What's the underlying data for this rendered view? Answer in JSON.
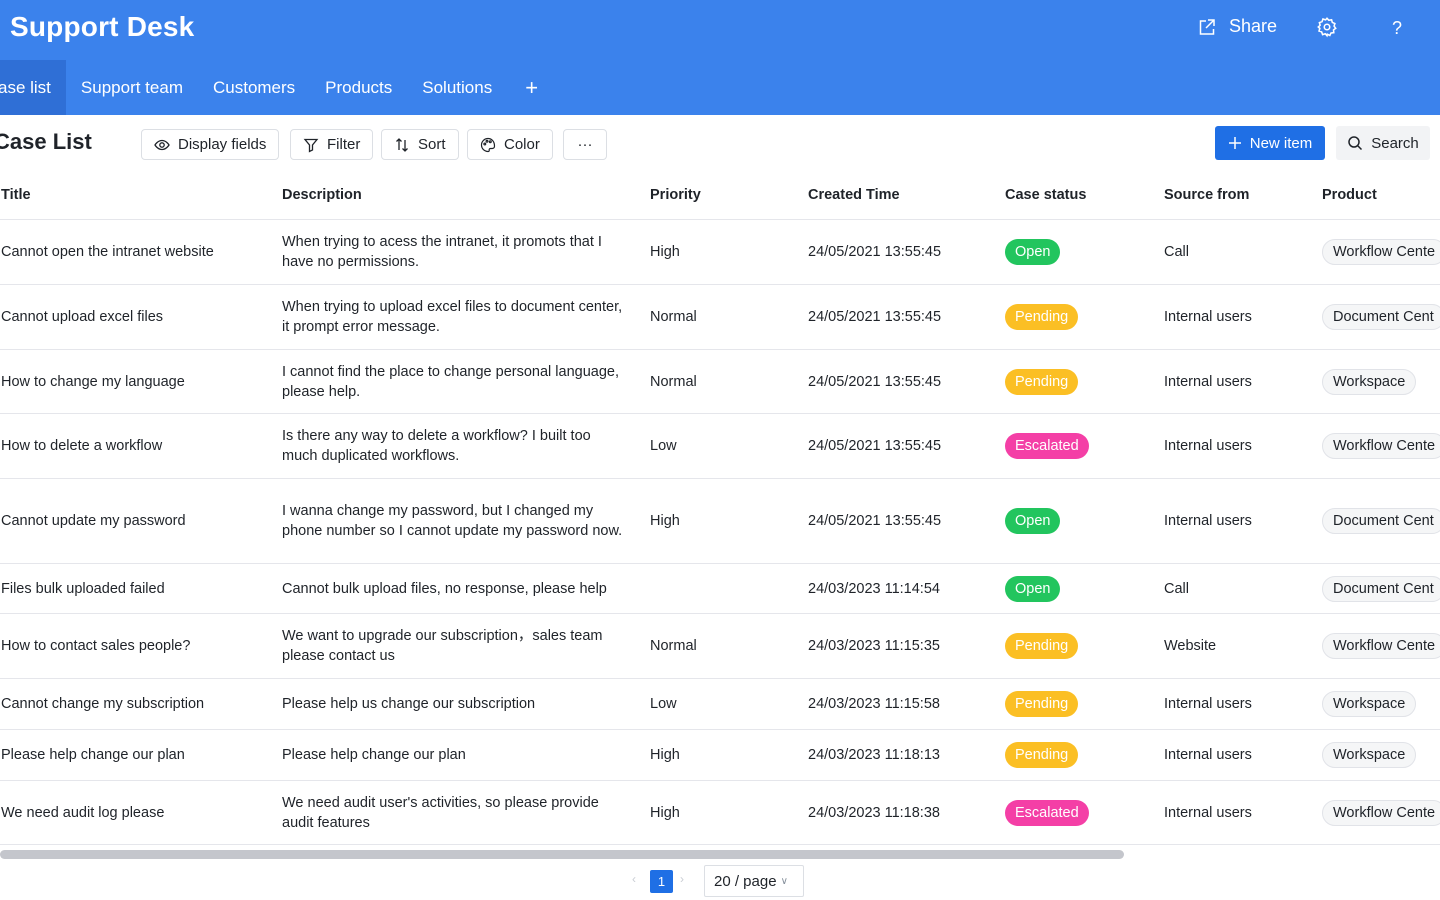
{
  "app": {
    "title": "Support Desk"
  },
  "header": {
    "share_label": "Share",
    "help_label": "?"
  },
  "tabs": [
    {
      "label": "ase list",
      "active": true
    },
    {
      "label": "Support team"
    },
    {
      "label": "Customers"
    },
    {
      "label": "Products"
    },
    {
      "label": "Solutions"
    }
  ],
  "tab_add_label": "+",
  "toolbar": {
    "title": "Case List",
    "display_fields": "Display fields",
    "filter": "Filter",
    "sort": "Sort",
    "color": "Color",
    "more": "···",
    "new_item": "New item",
    "search": "Search"
  },
  "columns": {
    "title": "Title",
    "description": "Description",
    "priority": "Priority",
    "created": "Created Time",
    "status": "Case status",
    "source": "Source from",
    "product": "Product"
  },
  "status_colors": {
    "Open": "#22c55e",
    "Pending": "#fbbf24",
    "Escalated": "#f43fa6"
  },
  "rows": [
    {
      "title": "Cannot open the intranet website",
      "description": "When trying to acess the intranet, it promots that I have no permissions.",
      "priority": "High",
      "created": "24/05/2021 13:55:45",
      "status": "Open",
      "source": "Call",
      "product": "Workflow Cente"
    },
    {
      "title": "Cannot upload excel files",
      "description": "When trying to upload excel files to document center, it prompt error message.",
      "priority": "Normal",
      "created": "24/05/2021 13:55:45",
      "status": "Pending",
      "source": "Internal users",
      "product": "Document Cent"
    },
    {
      "title": "How to change my language",
      "description": "I cannot find the place to change personal language, please help.",
      "priority": "Normal",
      "created": "24/05/2021 13:55:45",
      "status": "Pending",
      "source": "Internal users",
      "product": "Workspace"
    },
    {
      "title": "How to delete a workflow",
      "description": "Is there any way to delete a workflow? I built too much duplicated workflows.",
      "priority": "Low",
      "created": "24/05/2021 13:55:45",
      "status": "Escalated",
      "source": "Internal users",
      "product": "Workflow Cente"
    },
    {
      "title": "Cannot update my password",
      "description": "I wanna change my password, but I changed my phone number so I cannot update my password now.",
      "priority": "High",
      "created": "24/05/2021 13:55:45",
      "status": "Open",
      "source": "Internal users",
      "product": "Document Cent"
    },
    {
      "title": "Files bulk uploaded failed",
      "description": "Cannot bulk upload files, no response, please help",
      "priority": "",
      "created": "24/03/2023 11:14:54",
      "status": "Open",
      "source": "Call",
      "product": "Document Cent"
    },
    {
      "title": "How to contact sales people?",
      "description": "We want to upgrade our subscription，sales team please contact us",
      "priority": "Normal",
      "created": "24/03/2023 11:15:35",
      "status": "Pending",
      "source": "Website",
      "product": "Workflow Cente"
    },
    {
      "title": "Cannot change my subscription",
      "description": "Please help us change our subscription",
      "priority": "Low",
      "created": "24/03/2023 11:15:58",
      "status": "Pending",
      "source": "Internal users",
      "product": "Workspace"
    },
    {
      "title": "Please help change our plan",
      "description": "Please help change our plan",
      "priority": "High",
      "created": "24/03/2023 11:18:13",
      "status": "Pending",
      "source": "Internal users",
      "product": "Workspace"
    },
    {
      "title": "We need audit log please",
      "description": "We need audit user's activities, so please provide audit features",
      "priority": "High",
      "created": "24/03/2023 11:18:38",
      "status": "Escalated",
      "source": "Internal users",
      "product": "Workflow Cente"
    }
  ],
  "pagination": {
    "current_page": "1",
    "page_size": "20 / page",
    "prev": "‹",
    "next": "›"
  }
}
